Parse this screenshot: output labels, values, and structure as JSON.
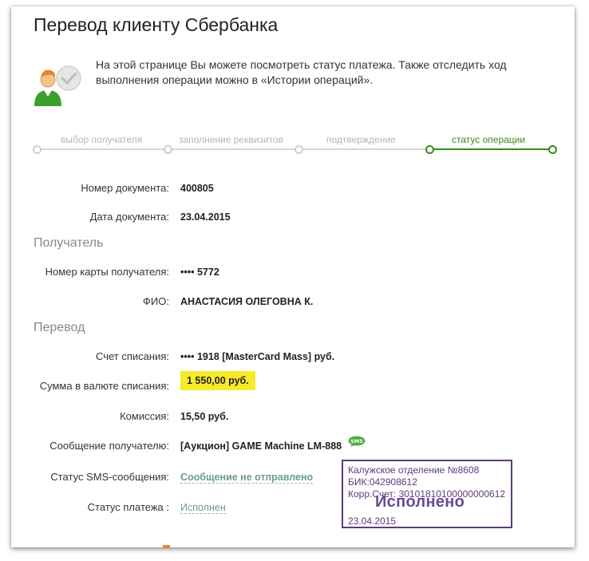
{
  "page": {
    "title": "Перевод клиенту Сбербанка",
    "info": "На этой странице Вы можете посмотреть статус платежа. Также отследить ход выполнения операции можно в «Истории операций»."
  },
  "steps": [
    {
      "label": "выбор получателя",
      "active": false
    },
    {
      "label": "заполнение реквизитов",
      "active": false
    },
    {
      "label": "подтверждение",
      "active": false
    },
    {
      "label": "статус операции",
      "active": true
    }
  ],
  "document": {
    "number_label": "Номер документа:",
    "number_value": "400805",
    "date_label": "Дата документа:",
    "date_value": "23.04.2015"
  },
  "recipient": {
    "section_title": "Получатель",
    "card_label": "Номер карты получателя:",
    "card_value": "•••• 5772",
    "name_label": "ФИО:",
    "name_value": "АНАСТАСИЯ ОЛЕГОВНА К."
  },
  "transfer": {
    "section_title": "Перевод",
    "account_label": "Счет списания:",
    "account_value": "•••• 1918  [MasterCard Mass]  руб.",
    "amount_label": "Сумма в валюте списания:",
    "amount_value": "1 550,00  руб.",
    "fee_label": "Комиссия:",
    "fee_value": "15,50 руб.",
    "message_label": "Сообщение получателю:",
    "message_value": "[Аукцион] GAME Machine LM-888",
    "sms_badge": "SMS",
    "sms_status_label": "Статус SMS-сообщения:",
    "sms_status_value": "Сообщение не отправлено",
    "payment_status_label": "Статус платежа :",
    "payment_status_value": "Исполнен"
  },
  "stamp": {
    "line1": "Калужское отделение №8608",
    "line2": "БИК:042908612",
    "line3": "Корр.Счет: 30101810100000000612",
    "status": "Исполнено",
    "date": "23.04.2015"
  },
  "colors": {
    "accent_green": "#3a8a1f",
    "highlight_yellow": "#f7ea2a",
    "stamp_purple": "#5b3a7e"
  }
}
